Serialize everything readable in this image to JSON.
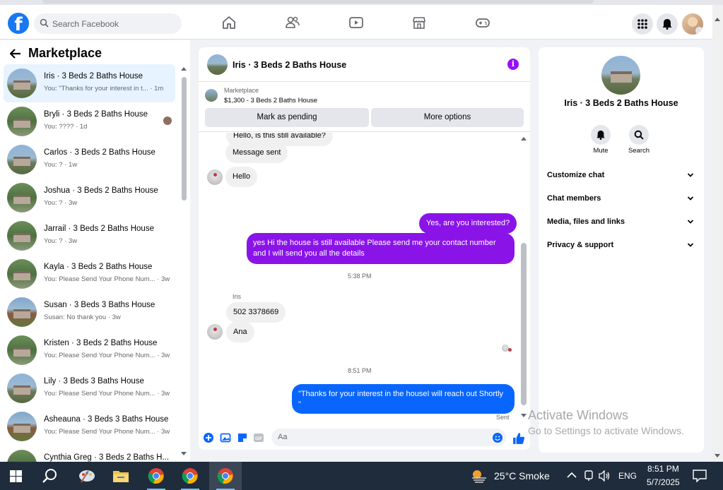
{
  "header": {
    "logo": "f",
    "search_placeholder": "Search Facebook"
  },
  "sidebar": {
    "title": "Marketplace",
    "conversations": [
      {
        "name": "Iris · 3 Beds 2 Baths House",
        "preview": "You: \"Thanks for your interest in t... · 1m"
      },
      {
        "name": "Bryli · 3 Beds 2 Baths House",
        "preview": "You: ???? · 1d"
      },
      {
        "name": "Carlos · 3 Beds 2 Baths House",
        "preview": "You: ? · 1w"
      },
      {
        "name": "Joshua · 3 Beds 2 Baths House",
        "preview": "You: ? · 3w"
      },
      {
        "name": "Jarrail · 3 Beds 2 Baths House",
        "preview": "You: ? · 3w"
      },
      {
        "name": "Kayla · 3 Beds 2 Baths House",
        "preview": "You: Please Send Your Phone Num... · 3w"
      },
      {
        "name": "Susan · 3 Beds 3 Baths House",
        "preview": "Susan: No thank you · 3w"
      },
      {
        "name": "Kristen · 3 Beds 2 Baths House",
        "preview": "You: Please Send Your Phone Num... · 3w"
      },
      {
        "name": "Lily · 3 Beds 3 Baths House",
        "preview": "You: Please Send Your Phone Num... · 3w"
      },
      {
        "name": "Asheauna · 3 Beds 3 Baths House",
        "preview": "You: Please Send Your Phone Num... · 3w"
      },
      {
        "name": "Cynthia Greg · 3 Beds 2 Baths H...",
        "preview": ""
      }
    ]
  },
  "chat": {
    "title": "Iris · 3 Beds 2 Baths House",
    "marketplace_label": "Marketplace",
    "listing": "$1,300 - 3 Beds 2 Baths House",
    "btn_pending": "Mark as pending",
    "btn_more": "More options",
    "messages": {
      "cut_top": "Hello, is this still available?",
      "m1": "Message sent",
      "m2": "Hello",
      "m3": "Yes, are you interested?",
      "m4a": "yes Hi the house is still available Please send me your contact number",
      "m4b": "and I will send you all the details",
      "time1": "5:38 PM",
      "sender": "Iris",
      "m5": "502 3378669",
      "m6": "Ana",
      "time2": "8:51 PM",
      "m7a": "\"Thanks for your interest in the houseI will reach out Shortly",
      "m7b": "\"",
      "status": "Sent"
    },
    "composer_placeholder": "Aa"
  },
  "info_panel": {
    "name": "Iris · 3 Beds 2 Baths House",
    "mute": "Mute",
    "search": "Search",
    "menu": [
      "Customize chat",
      "Chat members",
      "Media, files and links",
      "Privacy & support"
    ]
  },
  "watermark": {
    "line1": "Activate Windows",
    "line2": "Go to Settings to activate Windows."
  },
  "taskbar": {
    "weather": "25°C  Smoke",
    "lang": "ENG",
    "time": "8:51 PM",
    "date": "5/7/2025"
  },
  "colors": {
    "fb_blue": "#1877f2",
    "purple_bubble": "#8a14e8",
    "blue_bubble": "#0866ff",
    "taskbar": "#1f2c3c"
  }
}
